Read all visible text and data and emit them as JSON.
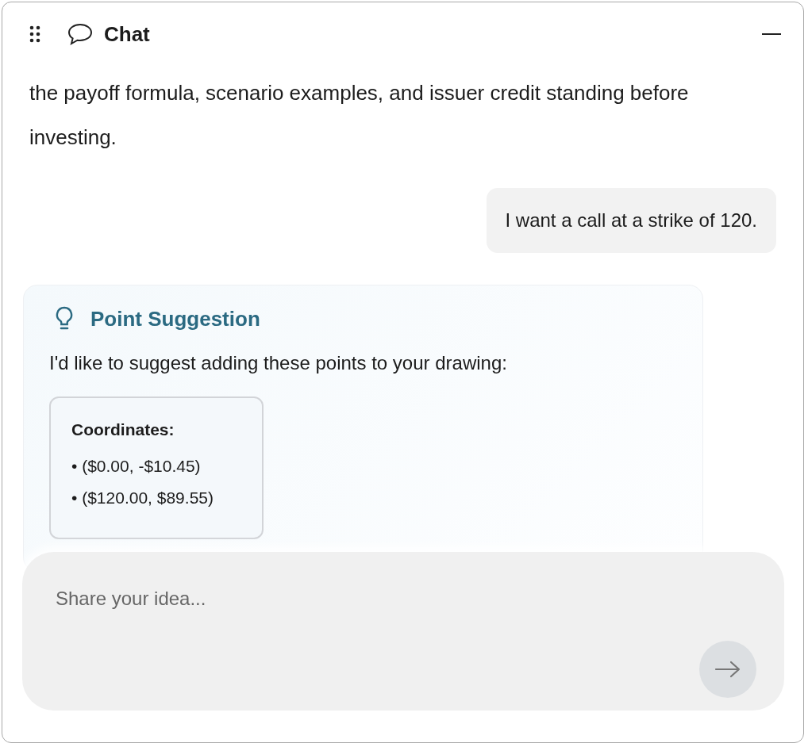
{
  "window": {
    "title": "Chat"
  },
  "messages": [
    {
      "kind": "assistant",
      "text": "the payoff formula, scenario examples, and issuer credit standing before investing."
    },
    {
      "kind": "user",
      "text": "I want a call at a strike of 120."
    },
    {
      "kind": "suggestion",
      "title": "Point Suggestion",
      "text": "I'd like to suggest adding these points to your drawing:",
      "coordinates": {
        "heading": "Coordinates:",
        "items": [
          "• ($0.00, -$10.45)",
          "• ($120.00, $89.55)"
        ]
      }
    }
  ],
  "input": {
    "placeholder": "Share your idea..."
  },
  "send_button": {
    "disabled": true
  }
}
